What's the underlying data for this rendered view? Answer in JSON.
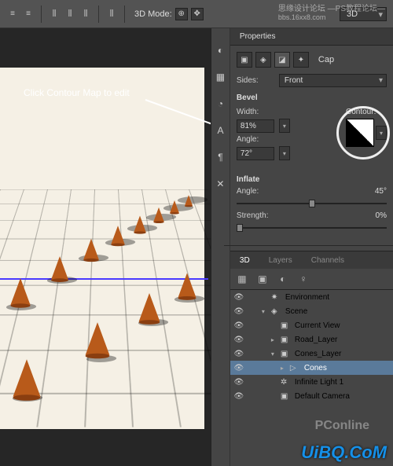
{
  "watermarks": {
    "top_left": "思缘设计论坛",
    "top_right": "—PS教程论坛—",
    "top_sub": "bbs.16xx8.com",
    "pconline": "PConline",
    "uibq": "UiBQ.CoM"
  },
  "toolbar": {
    "mode_label": "3D Mode:",
    "render_dropdown": "3D"
  },
  "annotation": {
    "text": "Click Contour Map to edit"
  },
  "properties": {
    "tab_label": "Properties",
    "mesh_name": "Cap",
    "sides_label": "Sides:",
    "sides_value": "Front",
    "bevel": {
      "section": "Bevel",
      "width_label": "Width:",
      "width_value": "81%",
      "angle_label": "Angle:",
      "angle_value": "72°",
      "contour_label": "Contour:"
    },
    "inflate": {
      "section": "Inflate",
      "angle_label": "Angle:",
      "angle_value": "45°",
      "strength_label": "Strength:",
      "strength_value": "0%"
    }
  },
  "panel3d": {
    "tabs": [
      "3D",
      "Layers",
      "Channels"
    ],
    "items": [
      {
        "label": "Environment",
        "icon": "✷",
        "indent": 0,
        "selected": false
      },
      {
        "label": "Scene",
        "icon": "◈",
        "indent": 0,
        "selected": false,
        "tri": "▾"
      },
      {
        "label": "Current View",
        "icon": "▣",
        "indent": 1,
        "selected": false
      },
      {
        "label": "Road_Layer",
        "icon": "▣",
        "indent": 1,
        "selected": false,
        "tri": "▸"
      },
      {
        "label": "Cones_Layer",
        "icon": "▣",
        "indent": 1,
        "selected": false,
        "tri": "▾"
      },
      {
        "label": "Cones",
        "icon": "▷",
        "indent": 2,
        "selected": true,
        "tri": "▸"
      },
      {
        "label": "Infinite Light 1",
        "icon": "✲",
        "indent": 1,
        "selected": false
      },
      {
        "label": "Default Camera",
        "icon": "▣",
        "indent": 1,
        "selected": false
      }
    ]
  }
}
